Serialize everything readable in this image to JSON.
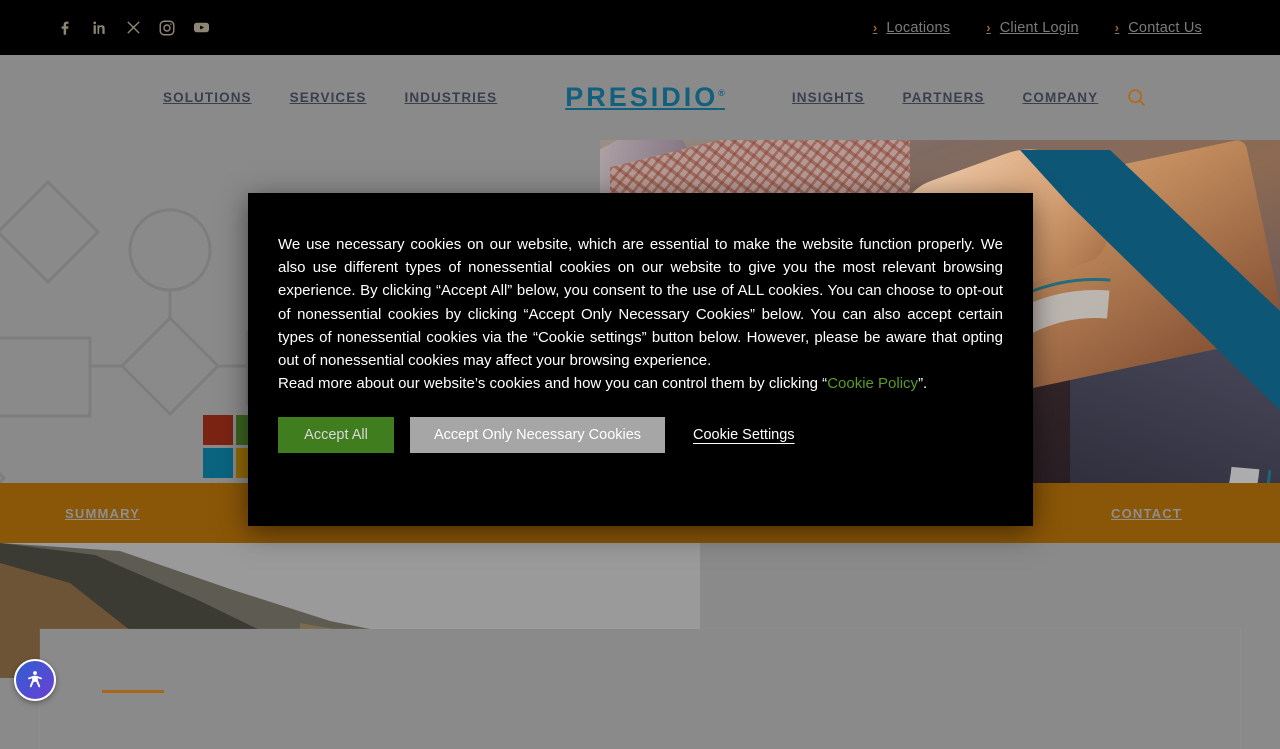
{
  "topbar": {
    "social": [
      {
        "name": "facebook-icon",
        "label": "Facebook"
      },
      {
        "name": "linkedin-icon",
        "label": "LinkedIn"
      },
      {
        "name": "x-twitter-icon",
        "label": "X"
      },
      {
        "name": "instagram-icon",
        "label": "Instagram"
      },
      {
        "name": "youtube-icon",
        "label": "YouTube"
      }
    ],
    "links": [
      {
        "label": "Locations",
        "chevron": "›"
      },
      {
        "label": "Client Login",
        "chevron": "›"
      },
      {
        "label": "Contact Us",
        "chevron": "›"
      }
    ]
  },
  "nav": {
    "left": [
      "SOLUTIONS",
      "SERVICES",
      "INDUSTRIES"
    ],
    "brand": "PRESIDIO",
    "brand_mark": "®",
    "right": [
      "INSIGHTS",
      "PARTNERS",
      "COMPANY"
    ],
    "search_icon": "search-icon"
  },
  "anchor_bar": {
    "first": "SUMMARY",
    "last": "CONTACT"
  },
  "cookie_modal": {
    "paragraph_1": "We use necessary cookies on our website, which are essential to make the website function properly. We also use different types of nonessential cookies on our website to give you the most relevant browsing experience. By clicking “Accept All” below, you consent to the use of ALL cookies. You can choose to opt-out of nonessential cookies by clicking “Accept Only Necessary Cookies” below. You can also accept certain types of nonessential cookies via the “Cookie settings” button below. However, please be aware that opting out of nonessential cookies may affect your browsing experience.",
    "paragraph_2_before": "Read more about our website’s cookies and how you can control them by clicking “",
    "policy_link": "Cookie Policy",
    "paragraph_2_after": "”.",
    "accept_all": "Accept All",
    "accept_necessary": "Accept Only Necessary Cookies",
    "cookie_settings": "Cookie Settings"
  },
  "accessibility": {
    "icon": "accessibility-person-icon"
  },
  "colors": {
    "brand_teal": "#10607e",
    "accent_orange": "#a8661b",
    "anchor_bar": "#8a5607",
    "accept_green": "#3f7d1f",
    "necessary_gray": "#a6a6a6",
    "policy_link_green": "#5a9b28",
    "modal_bg": "#000000",
    "page_dim": "#8a8a8a"
  }
}
